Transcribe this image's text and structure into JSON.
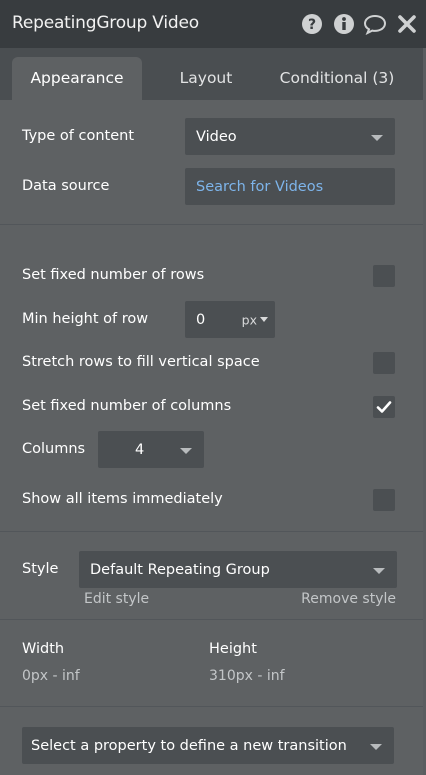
{
  "header": {
    "title": "RepeatingGroup Video",
    "icons": [
      "help-icon",
      "info-icon",
      "comment-icon",
      "close-icon"
    ]
  },
  "tabs": [
    {
      "label": "Appearance",
      "active": true
    },
    {
      "label": "Layout",
      "active": false
    },
    {
      "label": "Conditional (3)",
      "active": false
    }
  ],
  "content": {
    "type_label": "Type of content",
    "type_value": "Video",
    "source_label": "Data source",
    "source_value": "Search for Videos"
  },
  "rows": {
    "fixed_rows_label": "Set fixed number of rows",
    "fixed_rows_checked": false,
    "min_height_label": "Min height of row",
    "min_height_value": "0",
    "min_height_unit": "px",
    "stretch_label": "Stretch rows to fill vertical space",
    "stretch_checked": false,
    "fixed_cols_label": "Set fixed number of columns",
    "fixed_cols_checked": true,
    "columns_label": "Columns",
    "columns_value": "4",
    "show_all_label": "Show all items immediately",
    "show_all_checked": false
  },
  "style": {
    "label": "Style",
    "value": "Default Repeating Group",
    "edit": "Edit style",
    "remove": "Remove style"
  },
  "size": {
    "width_label": "Width",
    "width_value": "0px - inf",
    "height_label": "Height",
    "height_value": "310px - inf"
  },
  "transition": {
    "placeholder": "Select a property to define a new transition"
  },
  "colors": {
    "header_bg": "#383c3f",
    "panel_bg": "#5e6163",
    "field_bg": "#4b4f52",
    "link": "#7db4ea"
  }
}
